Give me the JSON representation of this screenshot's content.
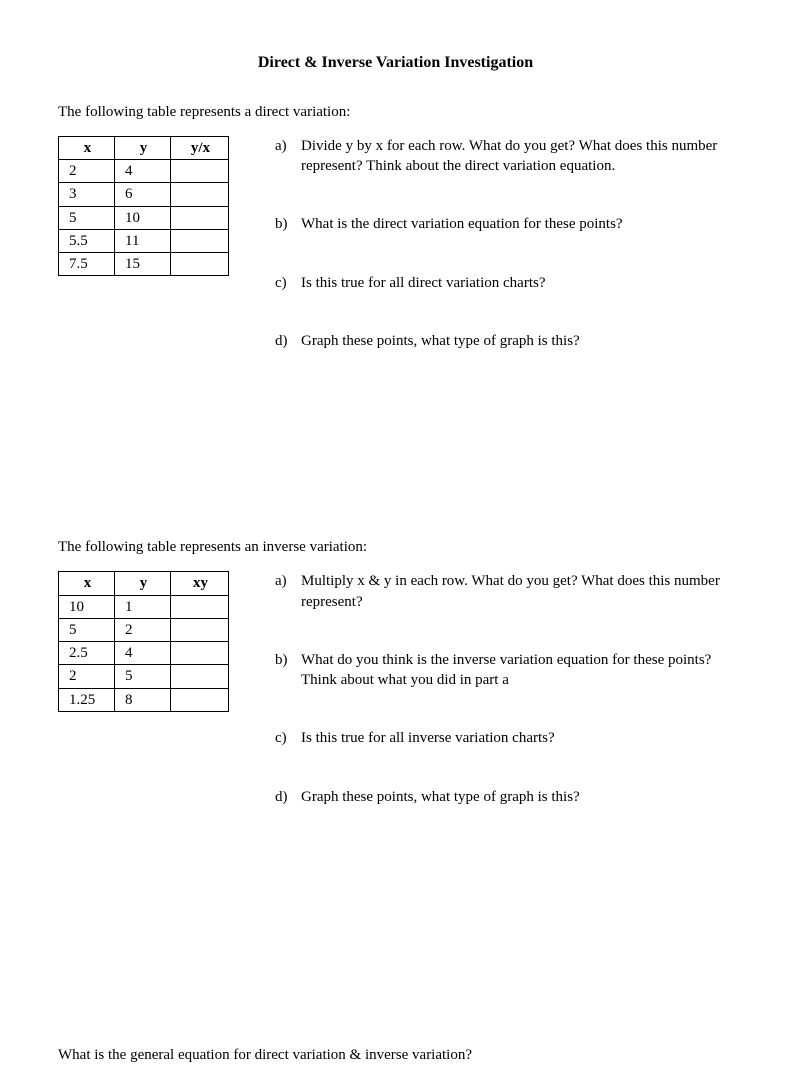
{
  "title": "Direct & Inverse Variation Investigation",
  "section1": {
    "intro": "The following table represents a direct variation:",
    "headers": {
      "x": "x",
      "y": "y",
      "calc": "y/x"
    },
    "rows": [
      {
        "x": "2",
        "y": "4",
        "calc": ""
      },
      {
        "x": "3",
        "y": "6",
        "calc": ""
      },
      {
        "x": "5",
        "y": "10",
        "calc": ""
      },
      {
        "x": "5.5",
        "y": "11",
        "calc": ""
      },
      {
        "x": "7.5",
        "y": "15",
        "calc": ""
      }
    ],
    "questions": [
      {
        "label": "a)",
        "text": "Divide y by x for each row. What do you get? What does this number represent? Think about the direct variation equation."
      },
      {
        "label": "b)",
        "text": "What is the direct variation equation for these points?"
      },
      {
        "label": "c)",
        "text": "Is this true for all direct variation charts?"
      },
      {
        "label": "d)",
        "text": "Graph these points, what type of graph is this?"
      }
    ]
  },
  "section2": {
    "intro": "The following table represents an inverse variation:",
    "headers": {
      "x": "x",
      "y": "y",
      "calc": "xy"
    },
    "rows": [
      {
        "x": "10",
        "y": "1",
        "calc": ""
      },
      {
        "x": "5",
        "y": "2",
        "calc": ""
      },
      {
        "x": "2.5",
        "y": "4",
        "calc": ""
      },
      {
        "x": "2",
        "y": "5",
        "calc": ""
      },
      {
        "x": "1.25",
        "y": "8",
        "calc": ""
      }
    ],
    "questions": [
      {
        "label": "a)",
        "text": "Multiply x & y in each row. What do you get? What does this number represent?"
      },
      {
        "label": "b)",
        "text": "What do you think is the inverse variation equation for these points? Think about what you did in part a"
      },
      {
        "label": "c)",
        "text": "Is this true for all inverse variation charts?"
      },
      {
        "label": "d)",
        "text": "Graph these points, what type of graph is this?"
      }
    ]
  },
  "final_question": "What is the general equation for direct variation & inverse variation?"
}
